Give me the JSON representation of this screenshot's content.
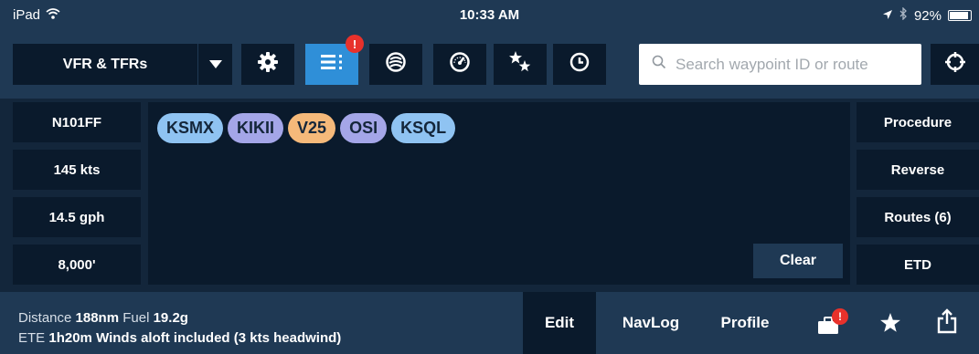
{
  "status": {
    "device": "iPad",
    "time": "10:33 AM",
    "battery": "92%",
    "battery_level": 0.92
  },
  "toolbar": {
    "layer_label": "VFR & TFRs",
    "flightplan_badge": "!",
    "search_placeholder": "Search waypoint ID or route"
  },
  "aircraft": [
    {
      "label": "N101FF"
    },
    {
      "label": "145 kts"
    },
    {
      "label": "14.5 gph"
    },
    {
      "label": "8,000'"
    }
  ],
  "route": [
    {
      "label": "KSMX",
      "color": "#8fc3f2"
    },
    {
      "label": "KIKII",
      "color": "#a4a6e8"
    },
    {
      "label": "V25",
      "color": "#f5b97a"
    },
    {
      "label": "OSI",
      "color": "#a4a6e8"
    },
    {
      "label": "KSQL",
      "color": "#8fc3f2"
    }
  ],
  "clear_label": "Clear",
  "actions": [
    {
      "label": "Procedure"
    },
    {
      "label": "Reverse"
    },
    {
      "label": "Routes (6)"
    },
    {
      "label": "ETD"
    }
  ],
  "summary": {
    "distance_label": "Distance",
    "distance_value": "188nm",
    "fuel_label": "Fuel",
    "fuel_value": "19.2g",
    "ete_label": "ETE",
    "ete_value": "1h20m",
    "winds_text": "Winds aloft included (3 kts headwind)"
  },
  "tabs": {
    "edit": "Edit",
    "navlog": "NavLog",
    "profile": "Profile"
  },
  "briefing_badge": "!",
  "colors": {
    "active_blue": "#2f8fd8",
    "badge_red": "#e8312b",
    "panel": "#0a1a2c",
    "bar": "#1f3954"
  }
}
